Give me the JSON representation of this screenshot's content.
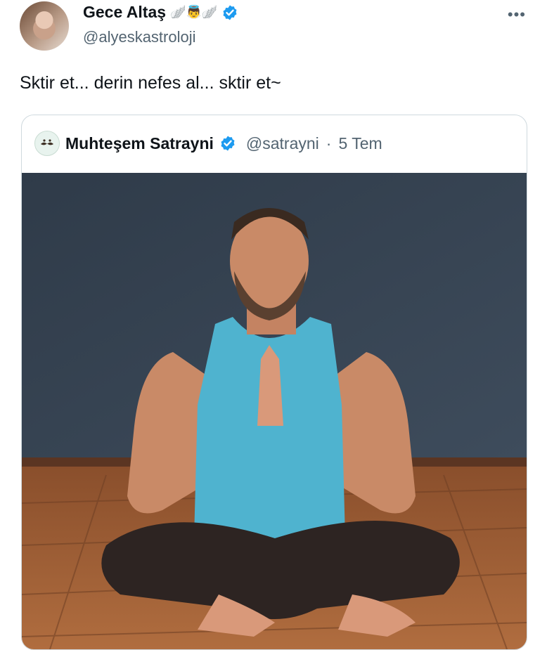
{
  "tweet": {
    "display_name": "Gece Altaş",
    "name_emoji": "🪽👼🪽",
    "handle": "@alyeskastroloji",
    "more_label": "•••",
    "text": "Sktir et... derin nefes al... sktir et~"
  },
  "quote": {
    "display_name": "Muhteşem Satrayni",
    "handle": "@satrayni",
    "separator": "·",
    "date": "5 Tem"
  },
  "colors": {
    "verified": "#1d9bf0",
    "secondary_text": "#536471",
    "border": "#cfd9de"
  }
}
